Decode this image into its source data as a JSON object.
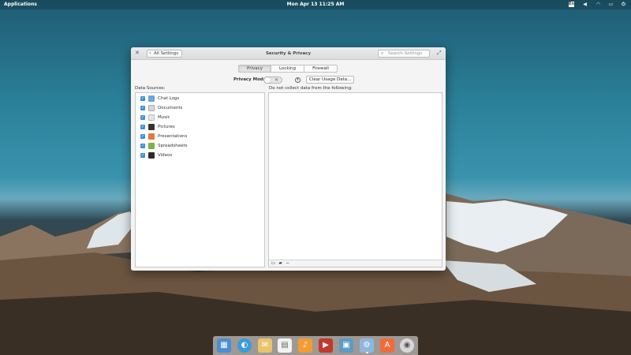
{
  "panel": {
    "applications_label": "Applications",
    "clock": "Mon Apr 13     11:25 AM"
  },
  "window": {
    "title": "Security & Privacy",
    "back_label": "All Settings",
    "search_placeholder": "Search Settings",
    "tabs": [
      {
        "label": "Privacy",
        "active": true
      },
      {
        "label": "Locking",
        "active": false
      },
      {
        "label": "Firewall",
        "active": false
      }
    ],
    "privacy_mode_label": "Privacy Mode:",
    "privacy_mode_on": false,
    "clear_button_label": "Clear Usage Data...",
    "data_sources_label": "Data Sources:",
    "exclusions_label": "Do not collect data from the following:",
    "data_sources": [
      {
        "label": "Chat Logs",
        "checked": true,
        "icon": "chat-icon",
        "color": "#6aa6d9"
      },
      {
        "label": "Documents",
        "checked": true,
        "icon": "document-icon",
        "color": "#d7d7d7"
      },
      {
        "label": "Music",
        "checked": true,
        "icon": "music-icon",
        "color": "#e5e5e5"
      },
      {
        "label": "Pictures",
        "checked": true,
        "icon": "picture-icon",
        "color": "#333333"
      },
      {
        "label": "Presentations",
        "checked": true,
        "icon": "presentation-icon",
        "color": "#e8743b"
      },
      {
        "label": "Spreadsheets",
        "checked": true,
        "icon": "spreadsheet-icon",
        "color": "#7cb342"
      },
      {
        "label": "Videos",
        "checked": true,
        "icon": "video-icon",
        "color": "#2b2b2b"
      }
    ]
  },
  "dock": {
    "apps": [
      {
        "name": "multitasking-view-icon",
        "color": "#4a8fd4",
        "glyph": "▦"
      },
      {
        "name": "web-browser-icon",
        "color": "#3b9bd9",
        "glyph": "◐"
      },
      {
        "name": "mail-icon",
        "color": "#e9c46a",
        "glyph": "✉"
      },
      {
        "name": "calendar-icon",
        "color": "#f2f2f2",
        "glyph": "▤"
      },
      {
        "name": "music-app-icon",
        "color": "#f39c33",
        "glyph": "♪"
      },
      {
        "name": "videos-app-icon",
        "color": "#c0392b",
        "glyph": "▶"
      },
      {
        "name": "photos-app-icon",
        "color": "#5d9cc4",
        "glyph": "▣"
      },
      {
        "name": "system-settings-icon",
        "color": "#8fb7dd",
        "glyph": "⚙"
      },
      {
        "name": "appcenter-icon",
        "color": "#ef6c3a",
        "glyph": "A"
      },
      {
        "name": "installer-icon",
        "color": "#d8d8d8",
        "glyph": "◉"
      }
    ]
  }
}
